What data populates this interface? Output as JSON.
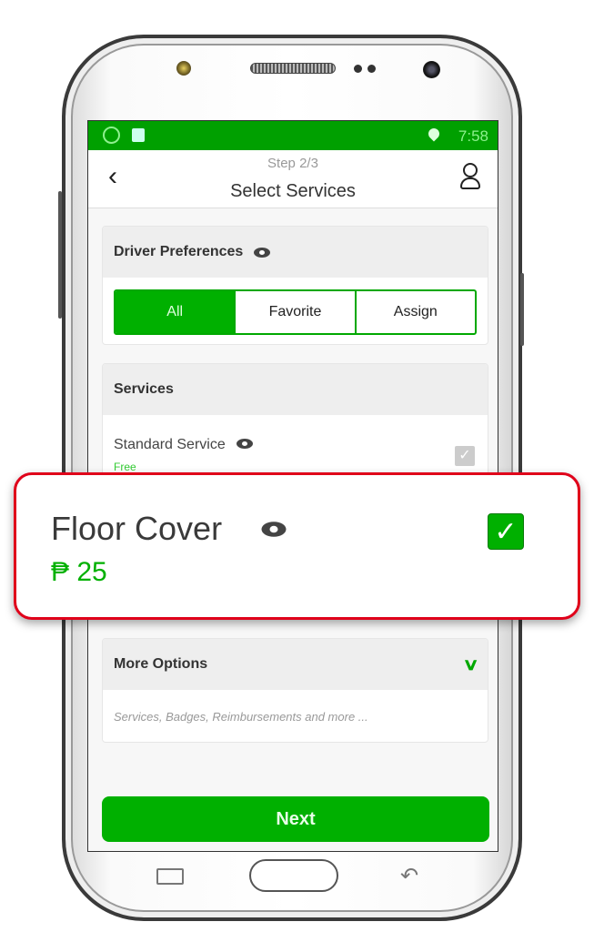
{
  "status_bar": {
    "time": "7:58",
    "icons": [
      "whatsapp-icon",
      "app-notification-icon",
      "location-pin-icon"
    ]
  },
  "header": {
    "step": "Step 2/3",
    "title": "Select Services",
    "back_icon": "chevron-left-icon",
    "support_icon": "headset-agent-icon"
  },
  "driver_preferences": {
    "title": "Driver Preferences",
    "options": [
      {
        "label": "All",
        "selected": true
      },
      {
        "label": "Favorite",
        "selected": false
      },
      {
        "label": "Assign",
        "selected": false
      }
    ]
  },
  "services": {
    "title": "Services",
    "items": [
      {
        "name": "Standard Service",
        "price": "Free",
        "checked": true,
        "disabled": true
      }
    ]
  },
  "callout": {
    "name": "Floor Cover",
    "price": "₱ 25",
    "checked": true
  },
  "more_options": {
    "title": "More Options",
    "description": "Services, Badges, Reimbursements and more ..."
  },
  "next_label": "Next",
  "colors": {
    "accent": "#00b000",
    "status_bar": "#00a000",
    "callout_border": "#e0001a"
  }
}
